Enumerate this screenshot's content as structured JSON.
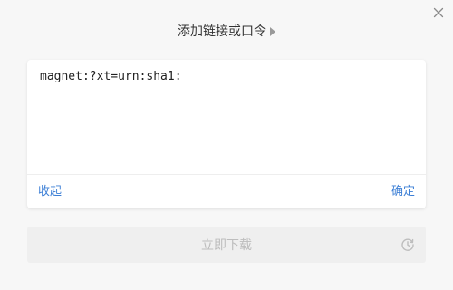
{
  "dialog": {
    "title": "添加链接或口令",
    "link_input": {
      "value": "magnet:?xt=urn:sha1:",
      "placeholder": ""
    },
    "collapse_label": "收起",
    "confirm_label": "确定",
    "download_label": "立即下载",
    "download_enabled": false
  },
  "colors": {
    "accent": "#3c7fd6",
    "disabled_text": "#bdbdbd",
    "disabled_bg": "#efefef"
  },
  "icons": {
    "close": "close-icon",
    "title_expand": "triangle-right-icon",
    "schedule": "clock-icon"
  }
}
